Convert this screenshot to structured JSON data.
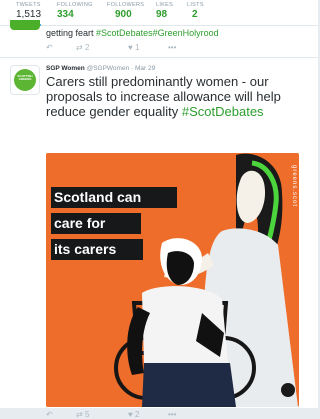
{
  "profile_stats": [
    {
      "label": "TWEETS",
      "value": "1,513"
    },
    {
      "label": "FOLLOWING",
      "value": "334"
    },
    {
      "label": "FOLLOWERS",
      "value": "900"
    },
    {
      "label": "LIKES",
      "value": "98"
    },
    {
      "label": "LISTS",
      "value": "2"
    }
  ],
  "prev_tweet": {
    "text": "getting feart",
    "hashtag1": "#ScotDebates",
    "hashtag2": "#GreenHolyrood",
    "retweets": "2",
    "likes": "1"
  },
  "tweet": {
    "author_name": "SGP Women",
    "author_handle": "@SGPWomen",
    "date": "· Mar 29",
    "text": "Carers still predominantly women - our proposals to increase allowance will help reduce gender equality",
    "hashtag": "#ScotDebates",
    "avatar_label": "SCOTTISH GREENS",
    "image": {
      "caption_lines": [
        "Scotland can",
        "care for",
        "its carers"
      ],
      "side_text": "greens.scot"
    },
    "retweets": "5",
    "likes": "2"
  },
  "colors": {
    "accent": "#2d9e2d",
    "image_bg": "#ef6d2a",
    "caption_bg": "#16181a"
  }
}
